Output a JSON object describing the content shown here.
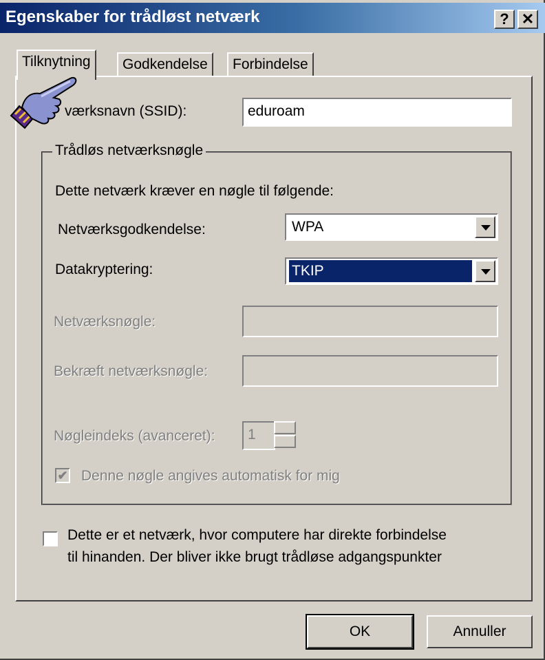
{
  "window": {
    "title": "Egenskaber for trådløst netværk",
    "help_button": "?",
    "close_button": "✕"
  },
  "tabs": [
    {
      "label": "Tilknytning",
      "active": true
    },
    {
      "label": "Godkendelse",
      "active": false
    },
    {
      "label": "Forbindelse",
      "active": false
    }
  ],
  "ssid": {
    "label": "Netværksnavn (SSID):",
    "label_visible": "værksnavn (SSID):",
    "value": "eduroam"
  },
  "group": {
    "title": "Trådløs netværksnøgle",
    "intro": "Dette netværk kræver en nøgle til følgende:",
    "auth_label": "Netværksgodkendelse:",
    "auth_value": "WPA",
    "encryption_label": "Datakryptering:",
    "encryption_value": "TKIP",
    "network_key_label": "Netværksnøgle:",
    "network_key_value": "",
    "confirm_key_label": "Bekræft netværksnøgle:",
    "confirm_key_value": "",
    "key_index_label": "Nøgleindeks (avanceret):",
    "key_index_value": "1",
    "auto_key_label": "Denne nøgle angives automatisk for mig",
    "auto_key_checked": true
  },
  "adhoc": {
    "line1": "Dette er et netværk, hvor computere har direkte forbindelse",
    "line2": "til hinanden. Der bliver ikke brugt trådløse adgangspunkter",
    "checked": false
  },
  "buttons": {
    "ok": "OK",
    "cancel": "Annuller"
  },
  "colors": {
    "face": "#d4d0c8",
    "title_start": "#0a246a",
    "title_end": "#a6caf0",
    "selection": "#0a246a"
  },
  "icons": {
    "pointer": "hand-pointer-icon",
    "dropdown": "chevron-down-icon",
    "checkmark": "checkmark-icon"
  }
}
